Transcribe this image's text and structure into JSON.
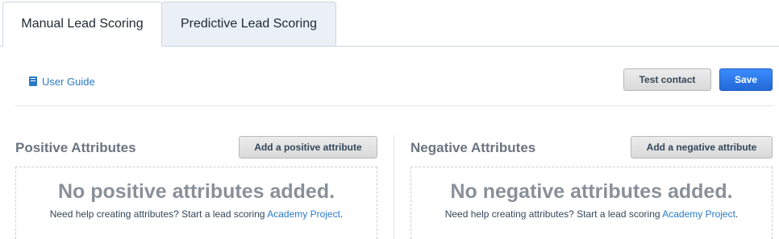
{
  "tabs": [
    {
      "label": "Manual Lead Scoring",
      "active": true
    },
    {
      "label": "Predictive Lead Scoring",
      "active": false
    }
  ],
  "toolbar": {
    "user_guide": "User Guide",
    "user_guide_icon": "book-icon",
    "test_contact": "Test contact",
    "save": "Save"
  },
  "positive": {
    "title": "Positive Attributes",
    "add_button": "Add a positive attribute",
    "empty_title": "No positive attributes added.",
    "help_prefix": "Need help creating attributes? Start a lead scoring",
    "help_link": "Academy Project",
    "help_suffix": "."
  },
  "negative": {
    "title": "Negative Attributes",
    "add_button": "Add a negative attribute",
    "empty_title": "No negative attributes added.",
    "help_prefix": "Need help creating attributes? Start a lead scoring",
    "help_link": "Academy Project",
    "help_suffix": "."
  },
  "colors": {
    "link": "#2a79c7",
    "save_button": "#2a73e0",
    "inactive_tab": "#eaf0f6"
  }
}
